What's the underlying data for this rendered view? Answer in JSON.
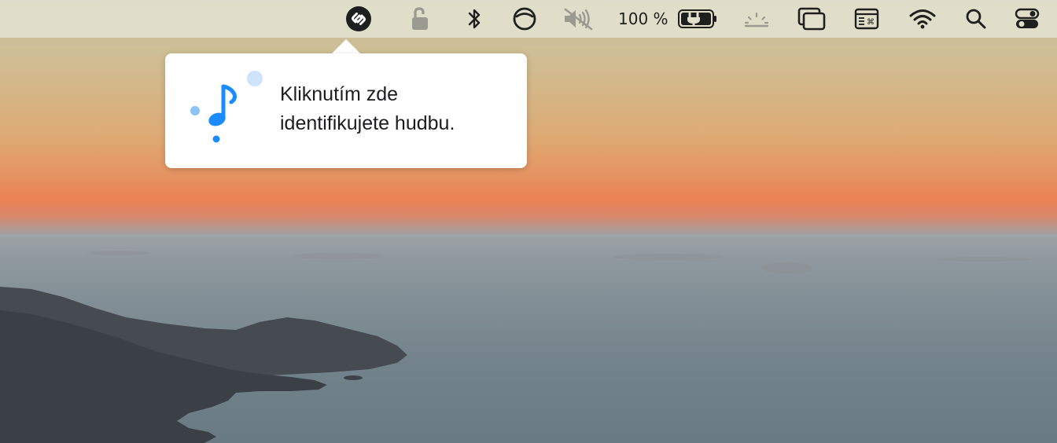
{
  "menubar": {
    "items": [
      {
        "icon": "shazam-icon"
      },
      {
        "icon": "lock-icon"
      },
      {
        "icon": "bluetooth-icon"
      },
      {
        "icon": "do-not-disturb-icon"
      },
      {
        "icon": "speaker-muted-icon"
      },
      {
        "icon": "battery-charging-icon"
      },
      {
        "icon": "brightness-icon"
      },
      {
        "icon": "window-switcher-icon"
      },
      {
        "icon": "keyboard-shortcut-icon"
      },
      {
        "icon": "wifi-icon"
      },
      {
        "icon": "search-icon"
      },
      {
        "icon": "control-center-icon"
      }
    ],
    "battery_percent": "100 %"
  },
  "popover": {
    "icon": "music-note-icon",
    "text": "Kliknutím zde\nidentifikujete hudbu."
  },
  "colors": {
    "accent_blue": "#1a8cff",
    "light_blue": "#a8d1f7",
    "menubar_icon": "#1f1f1f",
    "disabled_icon": "#9a9a90"
  }
}
